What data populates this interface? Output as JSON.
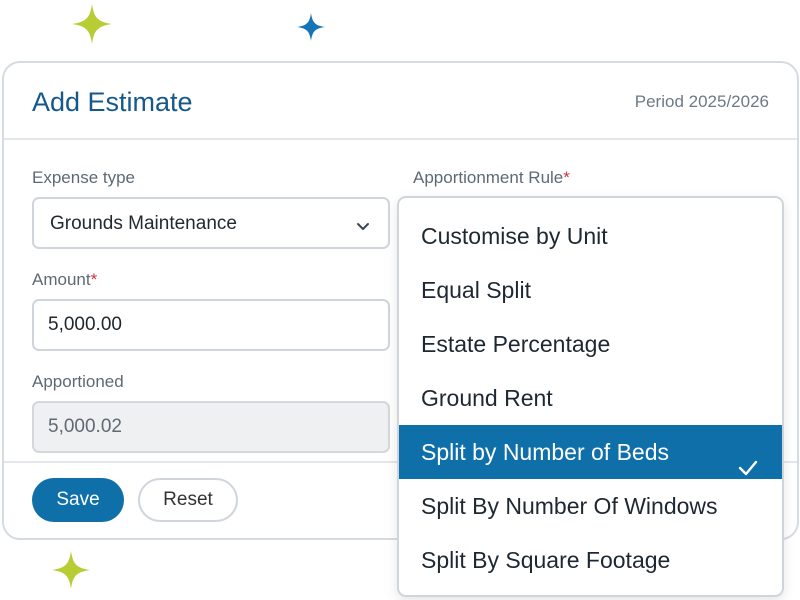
{
  "colors": {
    "sparkle_green": "#b7cd33",
    "sparkle_blue": "#1674b8",
    "primary": "#0f6fa8",
    "title": "#16588a",
    "required": "#d0323a"
  },
  "modal": {
    "title": "Add Estimate",
    "period": "Period 2025/2026"
  },
  "expense_type": {
    "label": "Expense type",
    "value": "Grounds Maintenance",
    "icon": "chevron-down-icon"
  },
  "apportionment_rule": {
    "label": "Apportionment Rule",
    "required_mark": "*",
    "options": [
      "Customise by Unit",
      "Equal Split",
      "Estate Percentage",
      "Ground Rent",
      "Split by Number of Beds",
      "Split By Number Of Windows",
      "Split By Square Footage"
    ],
    "selected": "Split by Number of Beds",
    "selected_icon": "check-icon"
  },
  "amount": {
    "label": "Amount",
    "required_mark": "*",
    "value": "5,000.00"
  },
  "apportioned": {
    "label": "Apportioned",
    "value": "5,000.02"
  },
  "buttons": {
    "save": "Save",
    "reset": "Reset"
  }
}
